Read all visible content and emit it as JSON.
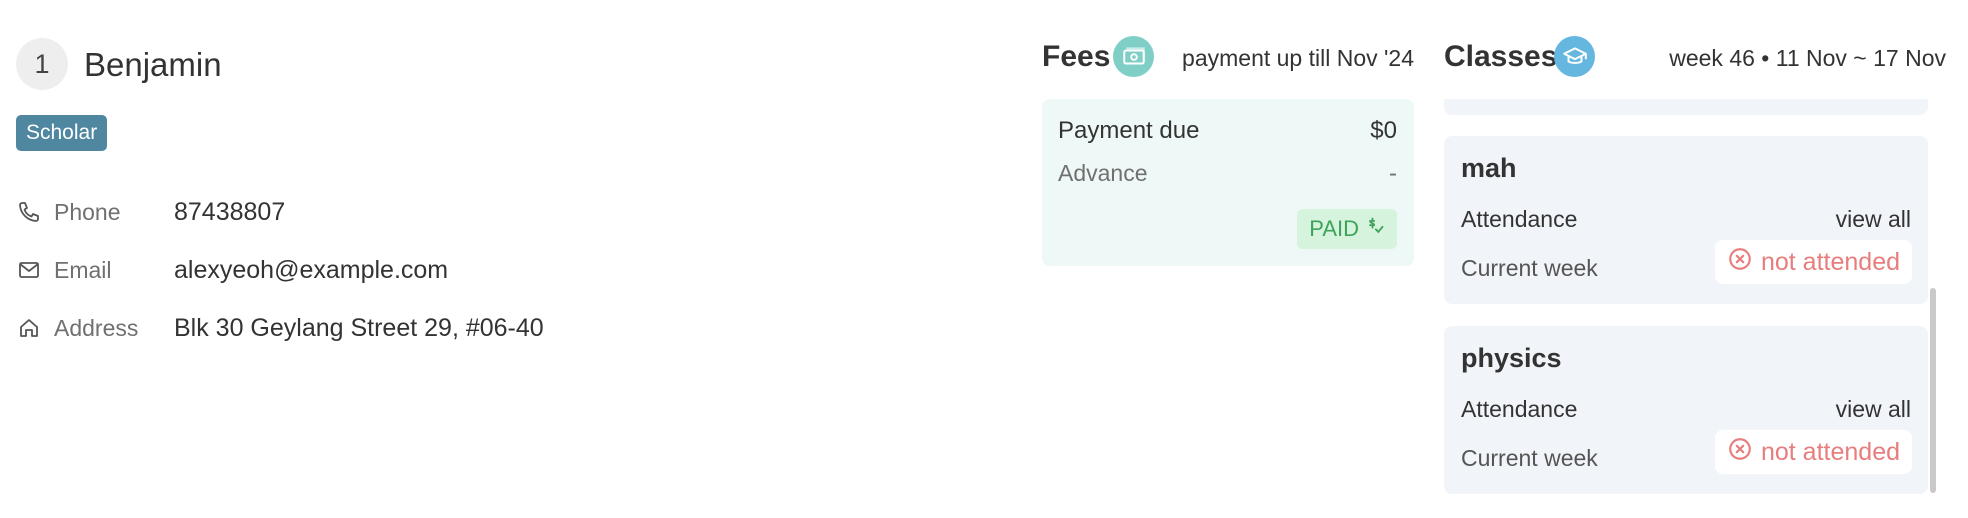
{
  "profile": {
    "index": "1",
    "name": "Benjamin",
    "tag": "Scholar",
    "fields": [
      {
        "icon": "phone-icon",
        "label": "Phone",
        "value": "87438807"
      },
      {
        "icon": "mail-icon",
        "label": "Email",
        "value": "alexyeoh@example.com"
      },
      {
        "icon": "home-icon",
        "label": "Address",
        "value": "Blk 30 Geylang Street 29, #06-40"
      }
    ]
  },
  "fees": {
    "title": "Fees",
    "icon": "money-icon",
    "subtitle": "payment up till Nov '24",
    "payment_due_label": "Payment due",
    "payment_due_value": "$0",
    "advance_label": "Advance",
    "advance_value": "-",
    "status": "PAID",
    "status_icon": "paid-check-icon",
    "colors": {
      "card_bg": "#eef8f6",
      "paid_bg": "#d6f3dd",
      "paid_text": "#3fa35a",
      "icon_bg": "#7fcfc7"
    }
  },
  "classes": {
    "title": "Classes",
    "icon": "graduation-cap-icon",
    "subtitle": "week 46 • 11 Nov ~ 17 Nov",
    "items": [
      {
        "name": "mah",
        "attendance_label": "Attendance",
        "view_all": "view all",
        "current_week_label": "Current week",
        "status": "not attended"
      },
      {
        "name": "physics",
        "attendance_label": "Attendance",
        "view_all": "view all",
        "current_week_label": "Current week",
        "status": "not attended"
      }
    ],
    "colors": {
      "card_bg": "#f1f5f9",
      "not_attended": "#e87d7d",
      "icon_bg": "#66b7e0"
    }
  },
  "accent": {
    "tag_bg": "#4f86a0"
  }
}
